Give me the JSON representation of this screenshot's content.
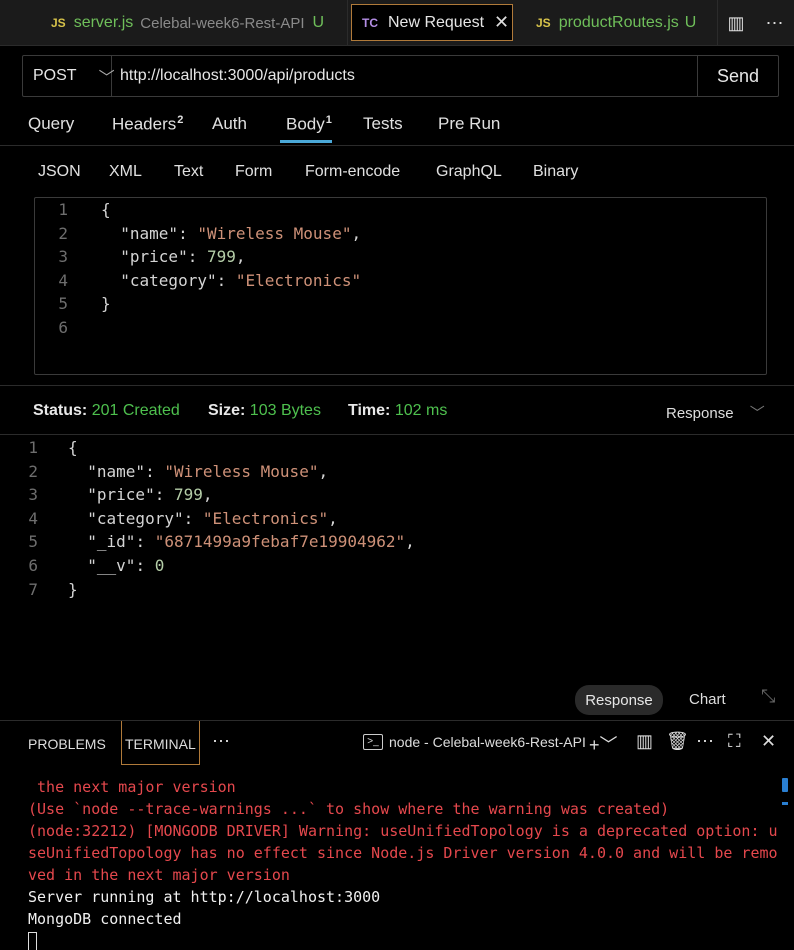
{
  "tabs": [
    {
      "badge": "JS",
      "name": "server.js",
      "subtitle": "Celebal-week6-Rest-API",
      "status": "U"
    },
    {
      "badge": "TC",
      "name": "New Request",
      "close": "✕"
    },
    {
      "badge": "JS",
      "name": "productRoutes.js",
      "status": "U"
    }
  ],
  "tab_tools": {
    "split": "▥",
    "more": "⋯"
  },
  "request": {
    "method": "POST",
    "url": "http://localhost:3000/api/products",
    "send_label": "Send"
  },
  "request_tabs": [
    {
      "label": "Query"
    },
    {
      "label": "Headers",
      "count": "2"
    },
    {
      "label": "Auth"
    },
    {
      "label": "Body",
      "count": "1"
    },
    {
      "label": "Tests"
    },
    {
      "label": "Pre Run"
    }
  ],
  "body_tabs": [
    "JSON",
    "XML",
    "Text",
    "Form",
    "Form-encode",
    "GraphQL",
    "Binary"
  ],
  "request_body": [
    {
      "n": "1",
      "text": "{"
    },
    {
      "n": "2",
      "key": "\"name\"",
      "val": "\"Wireless Mouse\"",
      "type": "str",
      "trail": ","
    },
    {
      "n": "3",
      "key": "\"price\"",
      "val": "799",
      "type": "num",
      "trail": ","
    },
    {
      "n": "4",
      "key": "\"category\"",
      "val": "\"Electronics\"",
      "type": "str",
      "trail": ""
    },
    {
      "n": "5",
      "text": "}"
    },
    {
      "n": "6",
      "text": ""
    }
  ],
  "status": {
    "status_label": "Status:",
    "status_value": "201 Created",
    "size_label": "Size:",
    "size_value": "103 Bytes",
    "time_label": "Time:",
    "time_value": "102 ms",
    "view": "Response"
  },
  "response_body": [
    {
      "n": "1",
      "text": "{"
    },
    {
      "n": "2",
      "key": "\"name\"",
      "val": "\"Wireless Mouse\"",
      "type": "str",
      "trail": ","
    },
    {
      "n": "3",
      "key": "\"price\"",
      "val": "799",
      "type": "num",
      "trail": ","
    },
    {
      "n": "4",
      "key": "\"category\"",
      "val": "\"Electronics\"",
      "type": "str",
      "trail": ","
    },
    {
      "n": "5",
      "key": "\"_id\"",
      "val": "\"6871499a9febaf7e19904962\"",
      "type": "str",
      "trail": ","
    },
    {
      "n": "6",
      "key": "\"__v\"",
      "val": "0",
      "type": "num",
      "trail": ""
    },
    {
      "n": "7",
      "text": "}"
    }
  ],
  "response_toggle": {
    "response": "Response",
    "chart": "Chart"
  },
  "panel": {
    "problems": "PROBLEMS",
    "terminal": "TERMINAL",
    "more": "⋯",
    "terminal_name": "node - Celebal-week6-Rest-API"
  },
  "terminal_lines": [
    {
      "color": "red",
      "text": " the next major version"
    },
    {
      "color": "red",
      "text": "(Use `node --trace-warnings ...` to show where the warning was created)"
    },
    {
      "color": "red",
      "text": "(node:32212) [MONGODB DRIVER] Warning: useUnifiedTopology is a deprecated option: u"
    },
    {
      "color": "red",
      "text": "seUnifiedTopology has no effect since Node.js Driver version 4.0.0 and will be remo"
    },
    {
      "color": "red",
      "text": "ved in the next major version"
    },
    {
      "color": "white",
      "text": "Server running at http://localhost:3000"
    },
    {
      "color": "white",
      "text": "MongoDB connected"
    }
  ]
}
